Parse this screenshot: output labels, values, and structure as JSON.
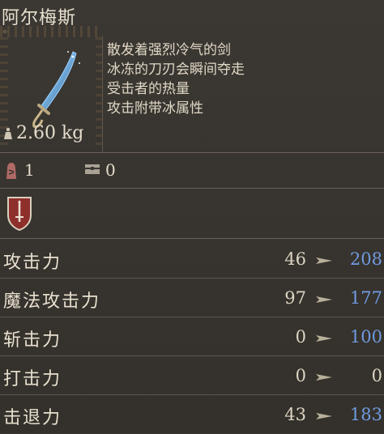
{
  "item": {
    "name": "阿尔梅斯",
    "weight": "2.60 kg",
    "description": [
      "散发着强烈冷气的剑",
      "冰冻的刀刃会瞬间夺走",
      "受击者的热量",
      "攻击附带冰属性"
    ]
  },
  "requirements": {
    "stat_value": "1",
    "slot_value": "0"
  },
  "stats": [
    {
      "label": "攻击力",
      "current": "46",
      "new": "208",
      "new_color": "#6f9be0"
    },
    {
      "label": "魔法攻击力",
      "current": "97",
      "new": "177",
      "new_color": "#6f9be0"
    },
    {
      "label": "斩击力",
      "current": "0",
      "new": "100",
      "new_color": "#6f9be0"
    },
    {
      "label": "打击力",
      "current": "0",
      "new": "0",
      "new_color": "#ddd5c3"
    },
    {
      "label": "击退力",
      "current": "43",
      "new": "183",
      "new_color": "#6f9be0"
    }
  ],
  "colors": {
    "accent_blue": "#6f9be0",
    "shield_red": "#8e2f2c",
    "arrow": "#b8b09a"
  },
  "icons": {
    "weight": "weight-icon",
    "requirement": "body-stat-icon",
    "slot": "chest-slot-icon",
    "emblem": "sword-shield-icon",
    "compare": "arrow-right-icon"
  }
}
